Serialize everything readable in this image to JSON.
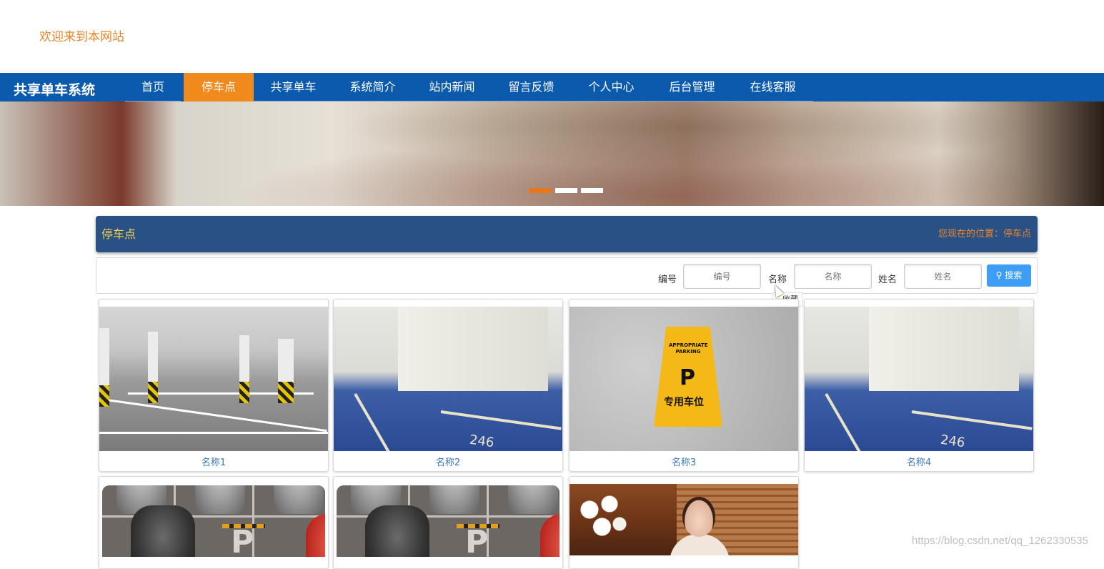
{
  "header": {
    "welcome_text": "欢迎来到本网站"
  },
  "nav": {
    "brand": "共享单车系统",
    "items": [
      {
        "label": "首页"
      },
      {
        "label": "停车点"
      },
      {
        "label": "共享单车"
      },
      {
        "label": "系统简介"
      },
      {
        "label": "站内新闻"
      },
      {
        "label": "留言反馈"
      },
      {
        "label": "个人中心"
      },
      {
        "label": "后台管理"
      },
      {
        "label": "在线客服"
      }
    ],
    "active_index": 1
  },
  "carousel": {
    "slide_count": 3,
    "active_slide": 1
  },
  "section": {
    "title": "停车点",
    "breadcrumb": "您现在的位置：停车点"
  },
  "search": {
    "fields": [
      {
        "label": "编号",
        "placeholder": "编号"
      },
      {
        "label": "名称",
        "placeholder": "名称"
      },
      {
        "label": "姓名",
        "placeholder": "姓名"
      }
    ],
    "button_label": "搜索",
    "button_icon": "magnifier-icon"
  },
  "favorite_tooltip": {
    "label": "收藏",
    "icon": "star-icon"
  },
  "cards": [
    {
      "caption": "名称1",
      "image": "underground-garage-grey"
    },
    {
      "caption": "名称2",
      "image": "garage-blue-floor"
    },
    {
      "caption": "名称3",
      "image": "yellow-parking-sign"
    },
    {
      "caption": "名称4",
      "image": "garage-blue-floor"
    },
    {
      "caption": "",
      "image": "cars-top-view"
    },
    {
      "caption": "",
      "image": "cars-top-view"
    },
    {
      "caption": "",
      "image": "woman-in-room"
    }
  ],
  "sign_text": {
    "top": "APPROPRIATE PARKING",
    "letter": "P",
    "chinese": "专用车位"
  },
  "floor_number": "246",
  "watermark": "https://blog.csdn.net/qq_1262330535",
  "colors": {
    "nav_bg": "#0b5aae",
    "nav_active": "#f08a1c",
    "section_header_bg": "#2a5186",
    "section_title": "#f6d44a",
    "accent_orange": "#e8852a",
    "search_button": "#3e9ef5",
    "caption_link": "#3a78b9"
  }
}
